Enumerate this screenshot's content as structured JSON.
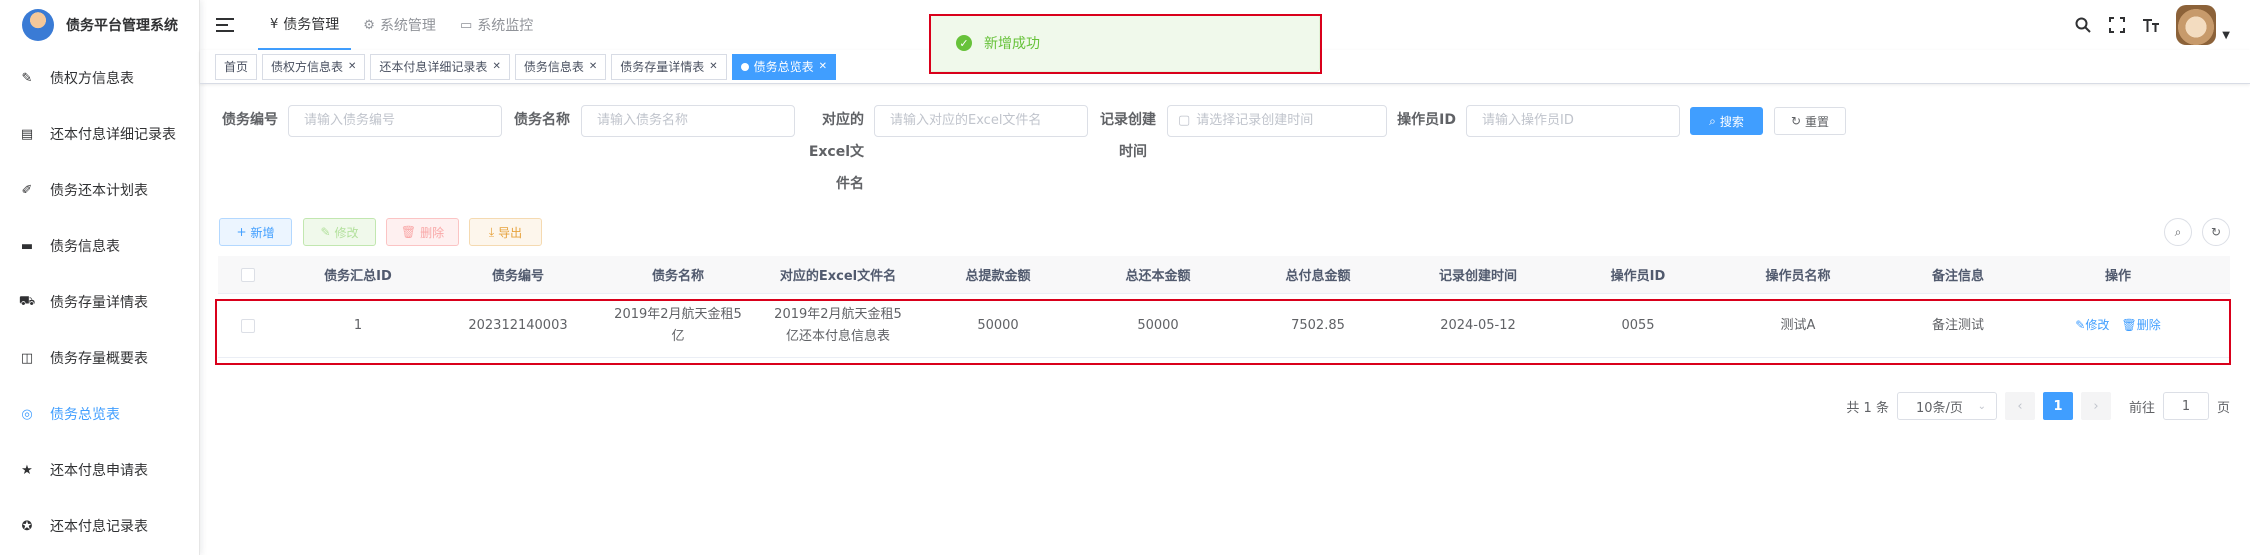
{
  "app": {
    "title": "债务平台管理系统"
  },
  "sidebar": {
    "items": [
      {
        "label": "债权方信息表",
        "icon": "edit-icon"
      },
      {
        "label": "还本付息详细记录表",
        "icon": "document-icon"
      },
      {
        "label": "债务还本计划表",
        "icon": "edit-note-icon"
      },
      {
        "label": "债务信息表",
        "icon": "message-icon"
      },
      {
        "label": "债务存量详情表",
        "icon": "cart-icon"
      },
      {
        "label": "债务存量概要表",
        "icon": "book-icon"
      },
      {
        "label": "债务总览表",
        "icon": "radio-icon",
        "active": true
      },
      {
        "label": "还本付息申请表",
        "icon": "star-icon"
      },
      {
        "label": "还本付息记录表",
        "icon": "circle-gear-icon"
      }
    ]
  },
  "topmenu": [
    {
      "label": "债务管理",
      "icon": "¥"
    },
    {
      "label": "系统管理",
      "icon": "⚙"
    },
    {
      "label": "系统监控",
      "icon": "▭"
    }
  ],
  "tags": [
    {
      "label": "首页"
    },
    {
      "label": "债权方信息表"
    },
    {
      "label": "还本付息详细记录表"
    },
    {
      "label": "债务信息表"
    },
    {
      "label": "债务存量详情表"
    },
    {
      "label": "债务总览表",
      "active": true
    }
  ],
  "toast": {
    "message": "新增成功"
  },
  "search": {
    "fields": [
      {
        "label": "债务编号",
        "placeholder": "请输入债务编号"
      },
      {
        "label": "债务名称",
        "placeholder": "请输入债务名称"
      },
      {
        "label_lines": [
          "对应的",
          "Excel文",
          "件名"
        ],
        "placeholder": "请输入对应的Excel文件名"
      },
      {
        "label_lines": [
          "记录创建",
          "时间"
        ],
        "placeholder": "请选择记录创建时间"
      },
      {
        "label": "操作员ID",
        "placeholder": "请输入操作员ID"
      }
    ],
    "search_label": "搜索",
    "reset_label": "重置"
  },
  "toolbar": {
    "add": "新增",
    "edit": "修改",
    "delete": "删除",
    "export": "导出"
  },
  "table": {
    "columns": [
      "债务汇总ID",
      "债务编号",
      "债务名称",
      "对应的Excel文件名",
      "总提款金额",
      "总还本金额",
      "总付息金额",
      "记录创建时间",
      "操作员ID",
      "操作员名称",
      "备注信息",
      "操作"
    ],
    "rows": [
      {
        "id": "1",
        "debt_no": "202312140003",
        "debt_name_lines": [
          "2019年2月航天金租5",
          "亿"
        ],
        "excel_lines": [
          "2019年2月航天金租5",
          "亿还本付息信息表"
        ],
        "total_draw": "50000",
        "total_principal": "50000",
        "total_interest": "7502.85",
        "created": "2024-05-12",
        "operator_id": "0055",
        "operator_name": "测试A",
        "remark": "备注测试",
        "edit": "修改",
        "delete": "删除"
      }
    ]
  },
  "pagination": {
    "total_text": "共 1 条",
    "page_size": "10条/页",
    "current": "1",
    "goto_prefix": "前往",
    "goto_value": "1",
    "goto_suffix": "页"
  }
}
